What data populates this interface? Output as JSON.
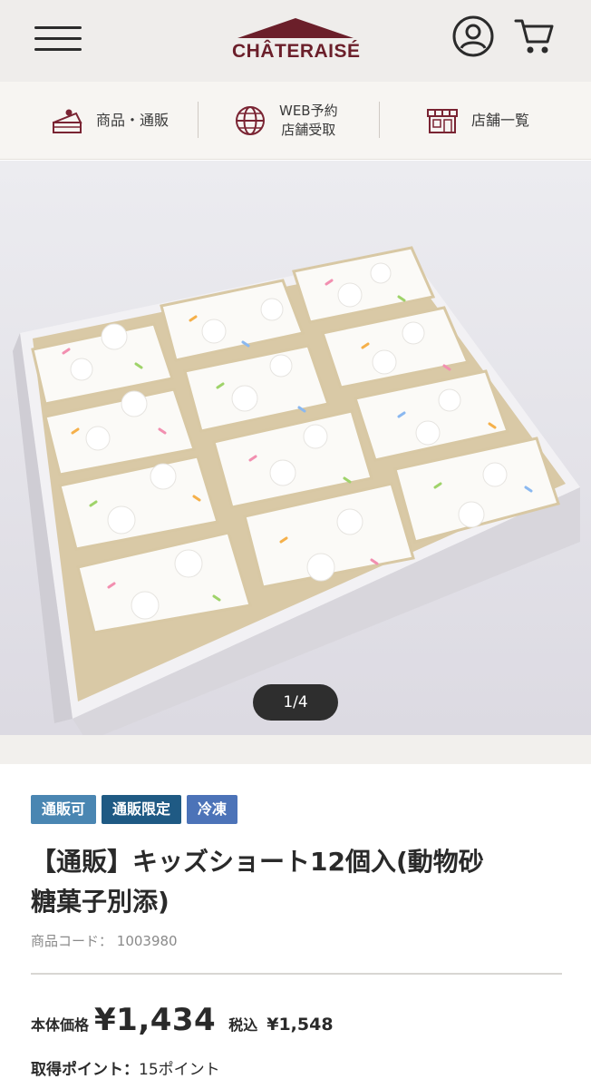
{
  "header": {
    "logo_text": "CHÂTERAISÉ",
    "colors": {
      "brand": "#6b1f2a",
      "header_bg": "#efedeb"
    }
  },
  "category_nav": [
    {
      "label": "商品・通販",
      "icon": "cake-icon"
    },
    {
      "label_line1": "WEB予約",
      "label_line2": "店舗受取",
      "icon": "globe-icon"
    },
    {
      "label": "店舗一覧",
      "icon": "store-icon"
    }
  ],
  "carousel": {
    "pager": "1/4"
  },
  "product": {
    "tags": [
      "通販可",
      "通販限定",
      "冷凍"
    ],
    "title": "【通販】キッズショート12個入(動物砂糖菓子別添)",
    "title_line1": "【通販】キッズショート12個入(動物砂",
    "title_line2": "糖菓子別添)",
    "code_label": "商品コード：",
    "code": "1003980",
    "price_label": "本体価格",
    "price": "¥1,434",
    "tax_label": "税込",
    "tax_price": "¥1,548",
    "points_label": "取得ポイント：",
    "points_value": "15ポイント"
  }
}
